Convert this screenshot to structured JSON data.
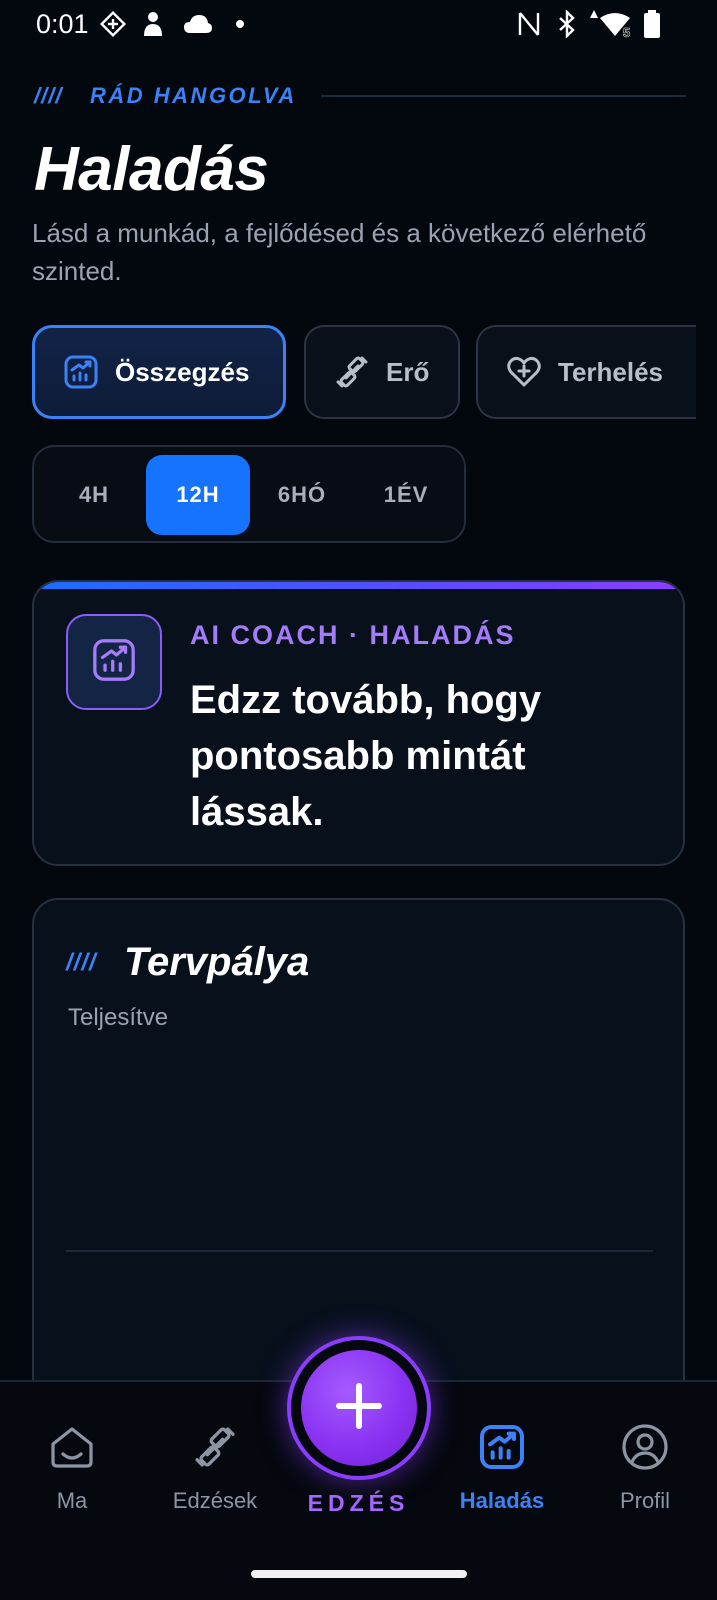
{
  "status_bar": {
    "time": "0:01",
    "left_icons": [
      "app-grid-icon",
      "person-icon",
      "cloud-icon",
      "dot-icon"
    ],
    "right_icons": [
      "nfc-icon",
      "bluetooth-icon",
      "wifi-icon",
      "battery-icon"
    ],
    "wifi_badge": "5"
  },
  "header": {
    "eyebrow_slashes": "////",
    "eyebrow": "RÁD HANGOLVA",
    "title": "Haladás",
    "subtitle": "Lásd a munkád, a fejlődésed és a következő elérhető szinted."
  },
  "categories": [
    {
      "label": "Összegzés",
      "icon": "chart-icon",
      "active": true
    },
    {
      "label": "Erő",
      "icon": "dumbbell-icon",
      "active": false
    },
    {
      "label": "Terhelés",
      "icon": "heart-plus-icon",
      "active": false
    }
  ],
  "periods": [
    {
      "label": "4H",
      "active": false
    },
    {
      "label": "12H",
      "active": true
    },
    {
      "label": "6HÓ",
      "active": false
    },
    {
      "label": "1ÉV",
      "active": false
    }
  ],
  "coach": {
    "kicker": "AI COACH · HALADÁS",
    "message": "Edzz tovább, hogy pontosabb mintát lássak."
  },
  "plan": {
    "slashes": "////",
    "title": "Tervpálya",
    "subtitle": "Teljesítve"
  },
  "nav": {
    "items": [
      {
        "label": "Ma",
        "icon": "home-icon",
        "active": false
      },
      {
        "label": "Edzések",
        "icon": "dumbbell-icon",
        "active": false
      },
      {
        "label": "Haladás",
        "icon": "chart-icon",
        "active": true
      },
      {
        "label": "Profil",
        "icon": "profile-icon",
        "active": false
      }
    ],
    "fab_label": "EDZÉS",
    "fab_icon": "plus-icon"
  },
  "colors": {
    "accent_blue": "#3b82f6",
    "active_segment": "#1673ff",
    "accent_purple": "#8b3dff",
    "background": "#03070e"
  }
}
